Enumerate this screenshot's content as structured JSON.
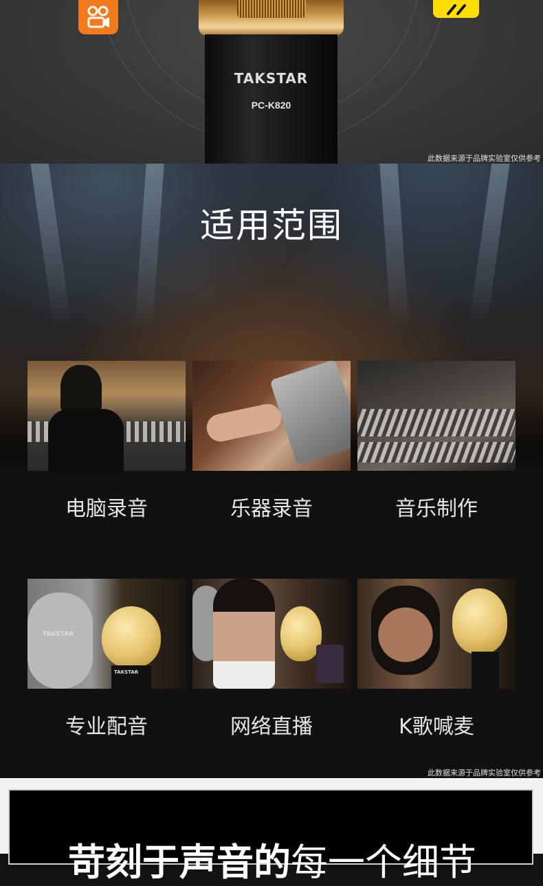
{
  "product": {
    "brand": "TAKSTAR",
    "model": "PC-K820"
  },
  "disclaimer_top": "此数据来源于品牌实验室仅供参考",
  "usage": {
    "title": "适用范围",
    "items": [
      {
        "label": "电脑录音"
      },
      {
        "label": "乐器录音"
      },
      {
        "label": "音乐制作"
      },
      {
        "label": "专业配音"
      },
      {
        "label": "网络直播"
      },
      {
        "label": "K歌喊麦"
      }
    ],
    "thumb_texts": {
      "headphone_brand": "TAKSTAR",
      "mic_brand": "TAKSTAR"
    },
    "disclaimer": "此数据来源于品牌实验室仅供参考"
  },
  "bottom": {
    "headline_bold": "苛刻于声音的",
    "headline_normal": "每一个细节"
  }
}
